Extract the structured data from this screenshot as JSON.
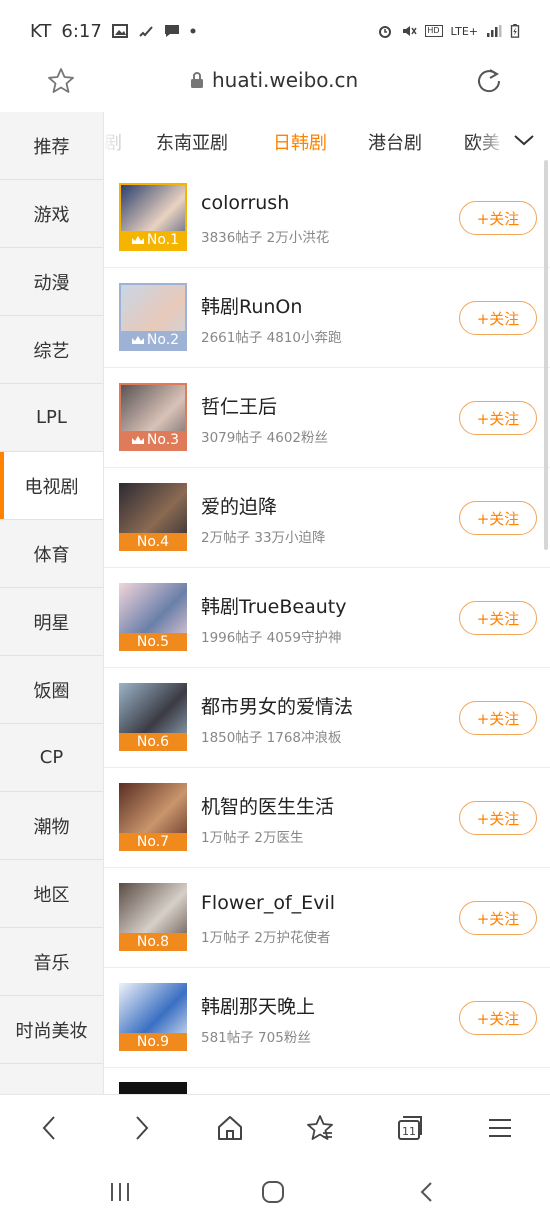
{
  "status_bar": {
    "carrier": "KT",
    "time": "6:17",
    "network": "LTE+",
    "left_icons": [
      "image-icon",
      "missed-call-icon",
      "chat-bubble-icon",
      "dot-icon"
    ],
    "right_icons": [
      "alarm-icon",
      "mute-icon",
      "hd-icon",
      "signal-icon",
      "battery-icon"
    ]
  },
  "url_bar": {
    "domain": "huati.weibo.cn",
    "icons": [
      "star-icon",
      "lock-icon",
      "reload-icon"
    ]
  },
  "sidebar": {
    "items": [
      {
        "label": "推荐"
      },
      {
        "label": "游戏"
      },
      {
        "label": "动漫"
      },
      {
        "label": "综艺"
      },
      {
        "label": "LPL"
      },
      {
        "label": "电视剧",
        "active": true
      },
      {
        "label": "体育"
      },
      {
        "label": "明星"
      },
      {
        "label": "饭圈"
      },
      {
        "label": "CP"
      },
      {
        "label": "潮物"
      },
      {
        "label": "地区"
      },
      {
        "label": "音乐"
      },
      {
        "label": "时尚美妆"
      }
    ]
  },
  "subtabs": {
    "items": [
      {
        "label": "剧"
      },
      {
        "label": "东南亚剧"
      },
      {
        "label": "日韩剧",
        "active": true
      },
      {
        "label": "港台剧"
      },
      {
        "label": "欧美"
      }
    ],
    "expand_icon": "chevron-down-icon",
    "accent": "#ff8200"
  },
  "topics": [
    {
      "rank": "No.1",
      "title": "colorrush",
      "meta": "3836帖子 2万小洪花",
      "follow": "+关注",
      "badge_color": "#f5b400",
      "crown": true,
      "thumb_colors": [
        "#2b3f6e",
        "#e9d2c0"
      ]
    },
    {
      "rank": "No.2",
      "title": "韩剧RunOn",
      "meta": "2661帖子 4810小奔跑",
      "follow": "+关注",
      "badge_color": "#9db2d4",
      "crown": true,
      "thumb_colors": [
        "#c9d6e6",
        "#e8c9b9"
      ]
    },
    {
      "rank": "No.3",
      "title": "哲仁王后",
      "meta": "3079帖子 4602粉丝",
      "follow": "+关注",
      "badge_color": "#e07b5a",
      "crown": true,
      "thumb_colors": [
        "#5a5454",
        "#d9c2b8"
      ]
    },
    {
      "rank": "No.4",
      "title": "爱的迫降",
      "meta": "2万帖子 33万小迫降",
      "follow": "+关注",
      "badge_color": "#f08a1c",
      "crown": false,
      "thumb_colors": [
        "#2c2a33",
        "#8a6a52"
      ]
    },
    {
      "rank": "No.5",
      "title": "韩剧TrueBeauty",
      "meta": "1996帖子 4059守护神",
      "follow": "+关注",
      "badge_color": "#f08a1c",
      "crown": false,
      "thumb_colors": [
        "#f2d5dc",
        "#6a7fa8"
      ]
    },
    {
      "rank": "No.6",
      "title": "都市男女的爱情法",
      "meta": "1850帖子 1768冲浪板",
      "follow": "+关注",
      "badge_color": "#f08a1c",
      "crown": false,
      "thumb_colors": [
        "#9bb4c8",
        "#3b3b44"
      ]
    },
    {
      "rank": "No.7",
      "title": "机智的医生生活",
      "meta": "1万帖子 2万医生",
      "follow": "+关注",
      "badge_color": "#f08a1c",
      "crown": false,
      "thumb_colors": [
        "#5a2e22",
        "#c9956d"
      ]
    },
    {
      "rank": "No.8",
      "title": "Flower_of_Evil",
      "meta": "1万帖子 2万护花使者",
      "follow": "+关注",
      "badge_color": "#f08a1c",
      "crown": false,
      "thumb_colors": [
        "#5a4c44",
        "#d6cfc8"
      ]
    },
    {
      "rank": "No.9",
      "title": "韩剧那天晚上",
      "meta": "581帖子 705粉丝",
      "follow": "+关注",
      "badge_color": "#f08a1c",
      "crown": false,
      "thumb_colors": [
        "#eef2f8",
        "#3a6fc2"
      ]
    }
  ],
  "browser_bar": {
    "icons": [
      "back-icon",
      "forward-icon",
      "home-icon",
      "bookmarks-icon",
      "tabs-icon",
      "menu-icon"
    ],
    "tab_count": "11"
  },
  "system_nav": {
    "icons": [
      "recent-apps-icon",
      "home-circle-icon",
      "system-back-icon"
    ]
  }
}
